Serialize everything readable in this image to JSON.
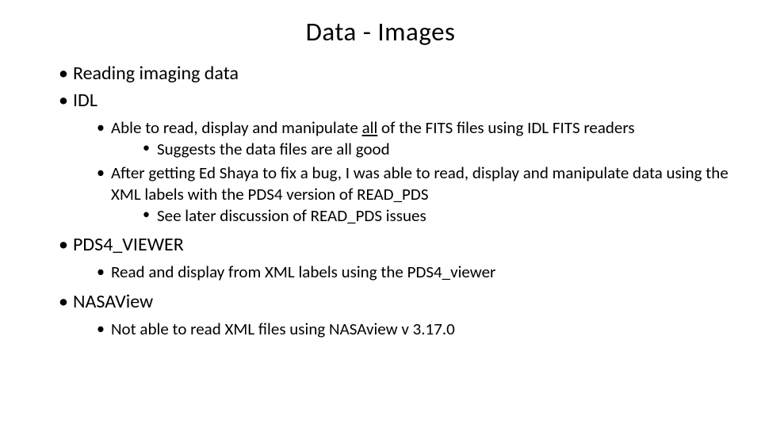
{
  "title": "Data - Images",
  "bullets": {
    "b1": "Reading imaging data",
    "b2": "IDL",
    "b2_1_pre": "Able to read, display and manipulate ",
    "b2_1_em": "all",
    "b2_1_post": " of the FITS files using IDL FITS readers",
    "b2_1_1": "Suggests the data files are all good",
    "b2_2": "After getting Ed Shaya to fix a bug, I was able to read, display and manipulate data using the XML labels with the PDS4 version of READ_PDS",
    "b2_2_1": "See later discussion of READ_PDS issues",
    "b3": "PDS4_VIEWER",
    "b3_1": "Read and display from XML labels using the PDS4_viewer",
    "b4": "NASAView",
    "b4_1": "Not able to read XML files using NASAview v 3.17.0"
  }
}
